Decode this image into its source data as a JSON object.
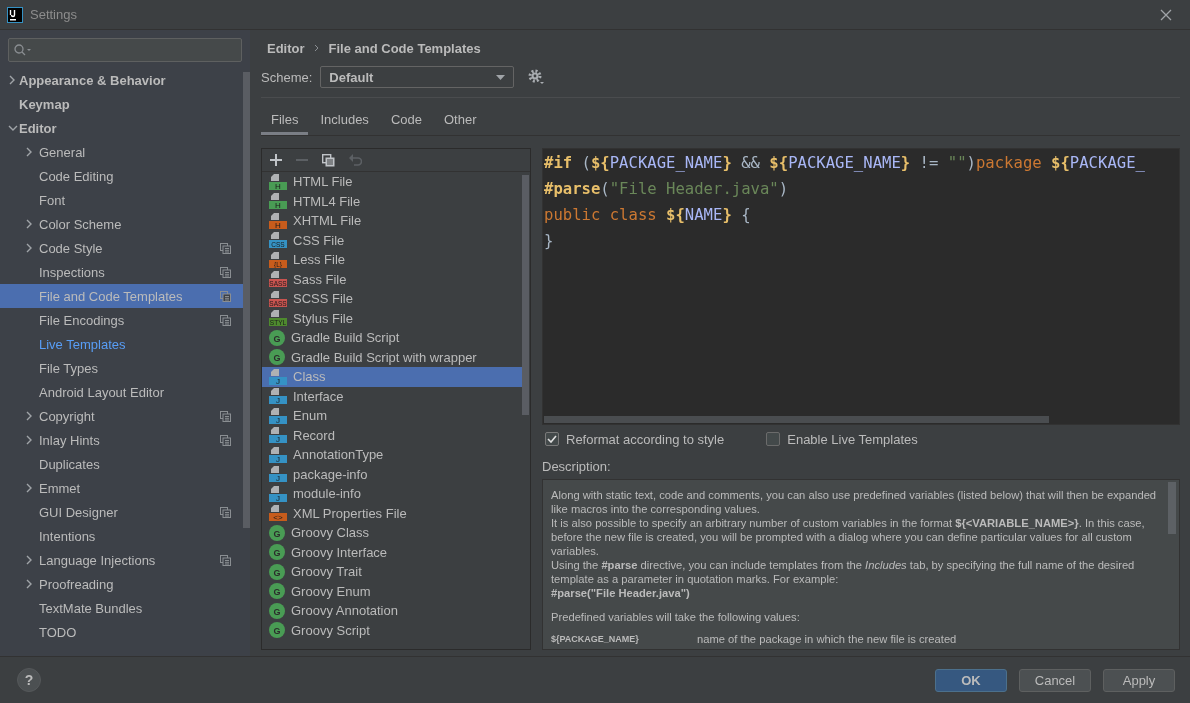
{
  "window": {
    "title": "Settings"
  },
  "sidebar": {
    "items": [
      {
        "label": "Appearance & Behavior",
        "expandable": true,
        "expanded": false,
        "selected": false,
        "project": false,
        "modified": false
      },
      {
        "label": "Keymap",
        "expandable": false,
        "selected": false,
        "project": false,
        "modified": false
      },
      {
        "label": "Editor",
        "expandable": true,
        "expanded": true,
        "selected": false,
        "project": false,
        "modified": false,
        "children": [
          {
            "label": "General",
            "expandable": true,
            "expanded": false,
            "selected": false,
            "project": false,
            "modified": false
          },
          {
            "label": "Code Editing",
            "expandable": false,
            "selected": false,
            "project": false,
            "modified": false
          },
          {
            "label": "Font",
            "expandable": false,
            "selected": false,
            "project": false,
            "modified": false
          },
          {
            "label": "Color Scheme",
            "expandable": true,
            "expanded": false,
            "selected": false,
            "project": false,
            "modified": false
          },
          {
            "label": "Code Style",
            "expandable": true,
            "expanded": false,
            "selected": false,
            "project": true,
            "modified": false
          },
          {
            "label": "Inspections",
            "expandable": false,
            "selected": false,
            "project": true,
            "modified": false
          },
          {
            "label": "File and Code Templates",
            "expandable": false,
            "selected": true,
            "project": true,
            "modified": false
          },
          {
            "label": "File Encodings",
            "expandable": false,
            "selected": false,
            "project": true,
            "modified": false
          },
          {
            "label": "Live Templates",
            "expandable": false,
            "selected": false,
            "project": false,
            "modified": true
          },
          {
            "label": "File Types",
            "expandable": false,
            "selected": false,
            "project": false,
            "modified": false
          },
          {
            "label": "Android Layout Editor",
            "expandable": false,
            "selected": false,
            "project": false,
            "modified": false
          },
          {
            "label": "Copyright",
            "expandable": true,
            "expanded": false,
            "selected": false,
            "project": true,
            "modified": false
          },
          {
            "label": "Inlay Hints",
            "expandable": true,
            "expanded": false,
            "selected": false,
            "project": true,
            "modified": false
          },
          {
            "label": "Duplicates",
            "expandable": false,
            "selected": false,
            "project": false,
            "modified": false
          },
          {
            "label": "Emmet",
            "expandable": true,
            "expanded": false,
            "selected": false,
            "project": false,
            "modified": false
          },
          {
            "label": "GUI Designer",
            "expandable": false,
            "selected": false,
            "project": true,
            "modified": false
          },
          {
            "label": "Intentions",
            "expandable": false,
            "selected": false,
            "project": false,
            "modified": false
          },
          {
            "label": "Language Injections",
            "expandable": true,
            "expanded": false,
            "selected": false,
            "project": true,
            "modified": false
          },
          {
            "label": "Proofreading",
            "expandable": true,
            "expanded": false,
            "selected": false,
            "project": false,
            "modified": false
          },
          {
            "label": "TextMate Bundles",
            "expandable": false,
            "selected": false,
            "project": false,
            "modified": false
          },
          {
            "label": "TODO",
            "expandable": false,
            "selected": false,
            "project": false,
            "modified": false
          }
        ]
      }
    ]
  },
  "breadcrumb": [
    "Editor",
    "File and Code Templates"
  ],
  "scheme": {
    "label": "Scheme:",
    "value": "Default"
  },
  "tabs": [
    {
      "label": "Files",
      "selected": true
    },
    {
      "label": "Includes",
      "selected": false
    },
    {
      "label": "Code",
      "selected": false
    },
    {
      "label": "Other",
      "selected": false
    }
  ],
  "templates": [
    {
      "label": "HTML File",
      "selected": false,
      "icon": {
        "kind": "file",
        "badge": "H",
        "color": "#499c54"
      }
    },
    {
      "label": "HTML4 File",
      "selected": false,
      "icon": {
        "kind": "file",
        "badge": "H",
        "color": "#499c54"
      }
    },
    {
      "label": "XHTML File",
      "selected": false,
      "icon": {
        "kind": "file",
        "badge": "H",
        "color": "#c75c1c"
      }
    },
    {
      "label": "CSS File",
      "selected": false,
      "icon": {
        "kind": "file",
        "badge": "CSS",
        "color": "#3592c4"
      }
    },
    {
      "label": "Less File",
      "selected": false,
      "icon": {
        "kind": "file",
        "badge": "{L}",
        "color": "#c75c1c"
      }
    },
    {
      "label": "Sass File",
      "selected": false,
      "icon": {
        "kind": "file",
        "badge": "SASS",
        "color": "#c75450"
      }
    },
    {
      "label": "SCSS File",
      "selected": false,
      "icon": {
        "kind": "file",
        "badge": "SASS",
        "color": "#c75450"
      }
    },
    {
      "label": "Stylus File",
      "selected": false,
      "icon": {
        "kind": "file",
        "badge": "STYL",
        "color": "#4e8a2e"
      }
    },
    {
      "label": "Gradle Build Script",
      "selected": false,
      "icon": {
        "kind": "circle",
        "badge": "G",
        "color": "#499c54"
      }
    },
    {
      "label": "Gradle Build Script with wrapper",
      "selected": false,
      "icon": {
        "kind": "circle",
        "badge": "G",
        "color": "#499c54"
      }
    },
    {
      "label": "Class",
      "selected": true,
      "icon": {
        "kind": "file",
        "badge": "J",
        "color": "#3592c4"
      }
    },
    {
      "label": "Interface",
      "selected": false,
      "icon": {
        "kind": "file",
        "badge": "J",
        "color": "#3592c4"
      }
    },
    {
      "label": "Enum",
      "selected": false,
      "icon": {
        "kind": "file",
        "badge": "J",
        "color": "#3592c4"
      }
    },
    {
      "label": "Record",
      "selected": false,
      "icon": {
        "kind": "file",
        "badge": "J",
        "color": "#3592c4"
      }
    },
    {
      "label": "AnnotationType",
      "selected": false,
      "icon": {
        "kind": "file",
        "badge": "J",
        "color": "#3592c4"
      }
    },
    {
      "label": "package-info",
      "selected": false,
      "icon": {
        "kind": "file",
        "badge": "J",
        "color": "#3592c4"
      }
    },
    {
      "label": "module-info",
      "selected": false,
      "icon": {
        "kind": "file",
        "badge": "J",
        "color": "#3592c4"
      }
    },
    {
      "label": "XML Properties File",
      "selected": false,
      "icon": {
        "kind": "file",
        "badge": "<>",
        "color": "#c75c1c"
      }
    },
    {
      "label": "Groovy Class",
      "selected": false,
      "icon": {
        "kind": "circle",
        "badge": "G",
        "color": "#499c54"
      }
    },
    {
      "label": "Groovy Interface",
      "selected": false,
      "icon": {
        "kind": "circle",
        "badge": "G",
        "color": "#499c54"
      }
    },
    {
      "label": "Groovy Trait",
      "selected": false,
      "icon": {
        "kind": "circle",
        "badge": "G",
        "color": "#499c54"
      }
    },
    {
      "label": "Groovy Enum",
      "selected": false,
      "icon": {
        "kind": "circle",
        "badge": "G",
        "color": "#499c54"
      }
    },
    {
      "label": "Groovy Annotation",
      "selected": false,
      "icon": {
        "kind": "circle",
        "badge": "G",
        "color": "#499c54"
      }
    },
    {
      "label": "Groovy Script",
      "selected": false,
      "icon": {
        "kind": "circle",
        "badge": "G",
        "color": "#499c54"
      }
    }
  ],
  "toolbar": [
    {
      "kind": "add",
      "disabled": false
    },
    {
      "kind": "remove",
      "disabled": true
    },
    {
      "kind": "copy",
      "disabled": false
    },
    {
      "kind": "reset",
      "disabled": true
    }
  ],
  "code": [
    [
      {
        "kind": "directive",
        "text": "#if"
      },
      {
        "kind": "plain",
        "text": " ("
      },
      {
        "kind": "brace",
        "text": "${"
      },
      {
        "kind": "variable",
        "text": "PACKAGE_NAME"
      },
      {
        "kind": "brace",
        "text": "}"
      },
      {
        "kind": "plain",
        "text": " && "
      },
      {
        "kind": "brace",
        "text": "${"
      },
      {
        "kind": "variable",
        "text": "PACKAGE_NAME"
      },
      {
        "kind": "brace",
        "text": "}"
      },
      {
        "kind": "plain",
        "text": " != "
      },
      {
        "kind": "string",
        "text": "\"\""
      },
      {
        "kind": "plain",
        "text": ")"
      },
      {
        "kind": "keyword",
        "text": "package "
      },
      {
        "kind": "brace",
        "text": "${"
      },
      {
        "kind": "variable",
        "text": "PACKAGE_"
      }
    ],
    [
      {
        "kind": "directive",
        "text": "#parse"
      },
      {
        "kind": "plain",
        "text": "("
      },
      {
        "kind": "string",
        "text": "\"File Header.java\""
      },
      {
        "kind": "plain",
        "text": ")"
      }
    ],
    [
      {
        "kind": "keyword",
        "text": "public class "
      },
      {
        "kind": "brace",
        "text": "${"
      },
      {
        "kind": "variable",
        "text": "NAME"
      },
      {
        "kind": "brace",
        "text": "}"
      },
      {
        "kind": "plain",
        "text": " {"
      }
    ],
    [
      {
        "kind": "plain",
        "text": "}"
      }
    ]
  ],
  "options": [
    {
      "label": "Reformat according to style",
      "checked": true
    },
    {
      "label": "Enable Live Templates",
      "checked": false
    }
  ],
  "description": {
    "label": "Description:",
    "lines": [
      "Along with static text, code and comments, you can also use predefined variables (listed below) that will then be expanded like macros into the corresponding values.",
      "It is also possible to specify an arbitrary number of custom variables in the format **${<VARIABLE_NAME>}**. In this case, before the new file is created, you will be prompted with a dialog where you can define particular values for all custom variables.",
      "Using the **#parse** directive, you can include templates from the *Includes* tab, by specifying the full name of the desired template as a parameter in quotation marks. For example:",
      "**#parse(\"File Header.java\")**"
    ],
    "intro": "Predefined variables will take the following values:",
    "variables": [
      {
        "name": "${PACKAGE_NAME}",
        "text": "name of the package in which the new file is created"
      }
    ]
  },
  "help": "?",
  "buttons": [
    {
      "label": "OK",
      "primary": true
    },
    {
      "label": "Cancel",
      "primary": false
    },
    {
      "label": "Apply",
      "primary": false
    }
  ]
}
